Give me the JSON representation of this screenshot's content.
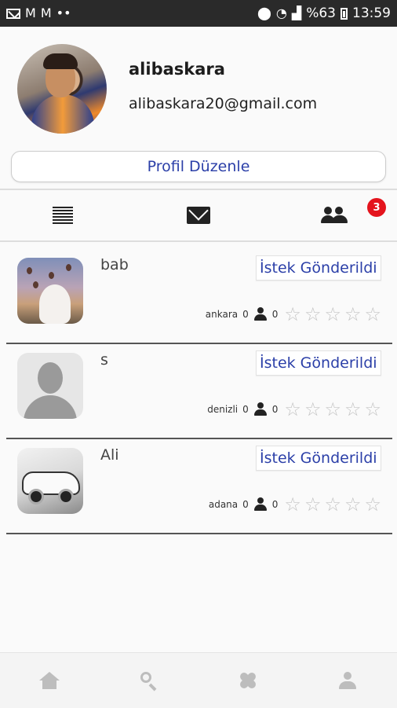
{
  "status_bar": {
    "battery": "%63",
    "time": "13:59"
  },
  "profile": {
    "username": "alibaskara",
    "email": "alibaskara20@gmail.com",
    "edit_label": "Profil Düzenle"
  },
  "tabs": {
    "friends_badge": "3"
  },
  "friends": [
    {
      "name": "bab",
      "button": "İstek Gönderildi",
      "city": "ankara",
      "count_a": "0",
      "count_b": "0",
      "rating": 0
    },
    {
      "name": "s",
      "button": "İstek Gönderildi",
      "city": "denizli",
      "count_a": "0",
      "count_b": "0",
      "rating": 0
    },
    {
      "name": "Ali",
      "button": "İstek Gönderildi",
      "city": "adana",
      "count_a": "0",
      "count_b": "0",
      "rating": 0
    }
  ],
  "colors": {
    "accent_text": "#2b3fa8",
    "badge": "#e4141d",
    "status_bar": "#2a2a2a"
  },
  "icons": {
    "status_left": [
      "gmail-icon",
      "mail-icon",
      "gmail-icon",
      "more-dots-icon"
    ],
    "status_right": [
      "location-icon",
      "wifi-icon",
      "signal-icon",
      "battery-icon"
    ],
    "tabs": [
      "list-icon",
      "mail-icon",
      "friends-icon"
    ],
    "bottom_nav": [
      "home-icon",
      "search-icon",
      "bandage-icon",
      "user-icon"
    ]
  }
}
